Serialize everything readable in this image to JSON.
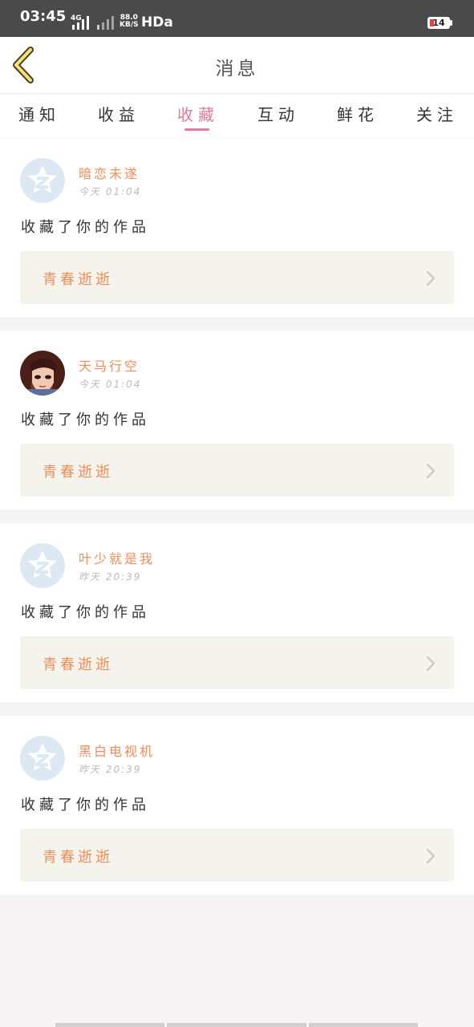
{
  "status_bar": {
    "time": "03:45",
    "network_type": "4G",
    "speed_value": "88.0",
    "speed_unit": "KB/S",
    "hd_label": "HDa",
    "battery": "14"
  },
  "header": {
    "title": "消息",
    "back_icon": "chevron-left-icon"
  },
  "tabs": [
    {
      "label": "通知",
      "active": false
    },
    {
      "label": "收益",
      "active": false
    },
    {
      "label": "收藏",
      "active": true
    },
    {
      "label": "互动",
      "active": false
    },
    {
      "label": "鲜花",
      "active": false
    },
    {
      "label": "关注",
      "active": false
    }
  ],
  "colors": {
    "accent_pink": "#e8799c",
    "username_orange": "#ee8e5c",
    "card_link_bg": "#f4f4ec",
    "back_icon_yellow": "#f3e27a"
  },
  "notifications": [
    {
      "username": "暗恋未遂",
      "time": "今天 01:04",
      "action": "收藏了你的作品",
      "work_title": "青春逝逝",
      "avatar": "qq-default-avatar"
    },
    {
      "username": "天马行空",
      "time": "今天 01:04",
      "action": "收藏了你的作品",
      "work_title": "青春逝逝",
      "avatar": "anime-character-avatar"
    },
    {
      "username": "叶少就是我",
      "time": "昨天 20:39",
      "action": "收藏了你的作品",
      "work_title": "青春逝逝",
      "avatar": "qq-default-avatar"
    },
    {
      "username": "黑白电视机",
      "time": "昨天 20:39",
      "action": "收藏了你的作品",
      "work_title": "青春逝逝",
      "avatar": "qq-default-avatar"
    }
  ]
}
